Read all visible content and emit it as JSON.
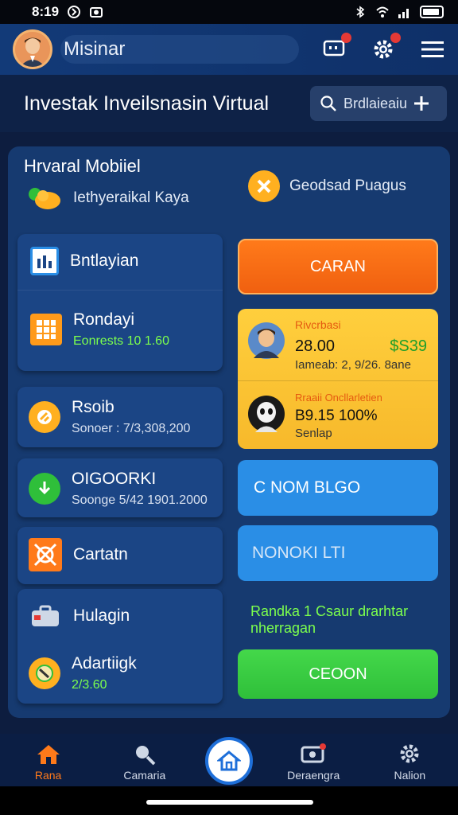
{
  "status_bar": {
    "time": "8:19"
  },
  "header": {
    "title": "Misinar"
  },
  "title_band": {
    "page_title": "Investak Inveilsnasin Virtual",
    "search_label": "Brdlaieaiu"
  },
  "panel": {
    "heading": "Hrvaral Mobiiel",
    "sub_label": "Iethyeraikal Kaya",
    "right_label": "Geodsad Puagus"
  },
  "left_cards": [
    {
      "label": "Bntlayian"
    },
    {
      "label": "Rondayi",
      "sub": "Eonrests 10 1.60"
    },
    {
      "label": "Rsoib",
      "sub": "Sonoer : 7/3,308,200"
    },
    {
      "label": "OIGOORKI",
      "sub": "Soonge 5/42 1901.2000"
    },
    {
      "label": "Cartatn"
    },
    {
      "label": "Hulagin"
    },
    {
      "label": "Adartiigk",
      "sub": "2/3.60"
    }
  ],
  "right_panel": {
    "orange_button": "CARAN",
    "yellow_card": {
      "top_title": "Rivcrbasi",
      "top_value": "28.00",
      "top_amount": "$S39",
      "top_sub": "Iameab: 2, 9/26. 8ane",
      "bottom_title": "Rraaii Oncllarletien",
      "bottom_value": "B9.15 100%",
      "bottom_sub": "Senlap"
    },
    "blue_button_1": "C  NOM BLGO",
    "blue_button_2": "NONOKI LTI",
    "promo_text": "Randka 1 Csaur drarhtar nherragan",
    "green_button": "CEOON"
  },
  "bottom_nav": [
    {
      "label": "Rana"
    },
    {
      "label": "Camaria"
    },
    {
      "label": "Deraengra"
    },
    {
      "label": "Nalion"
    }
  ],
  "colors": {
    "accent_orange": "#ff7a1a",
    "panel_blue": "#163a70",
    "green": "#3fcf3f",
    "yellow": "#ffcf3d"
  }
}
